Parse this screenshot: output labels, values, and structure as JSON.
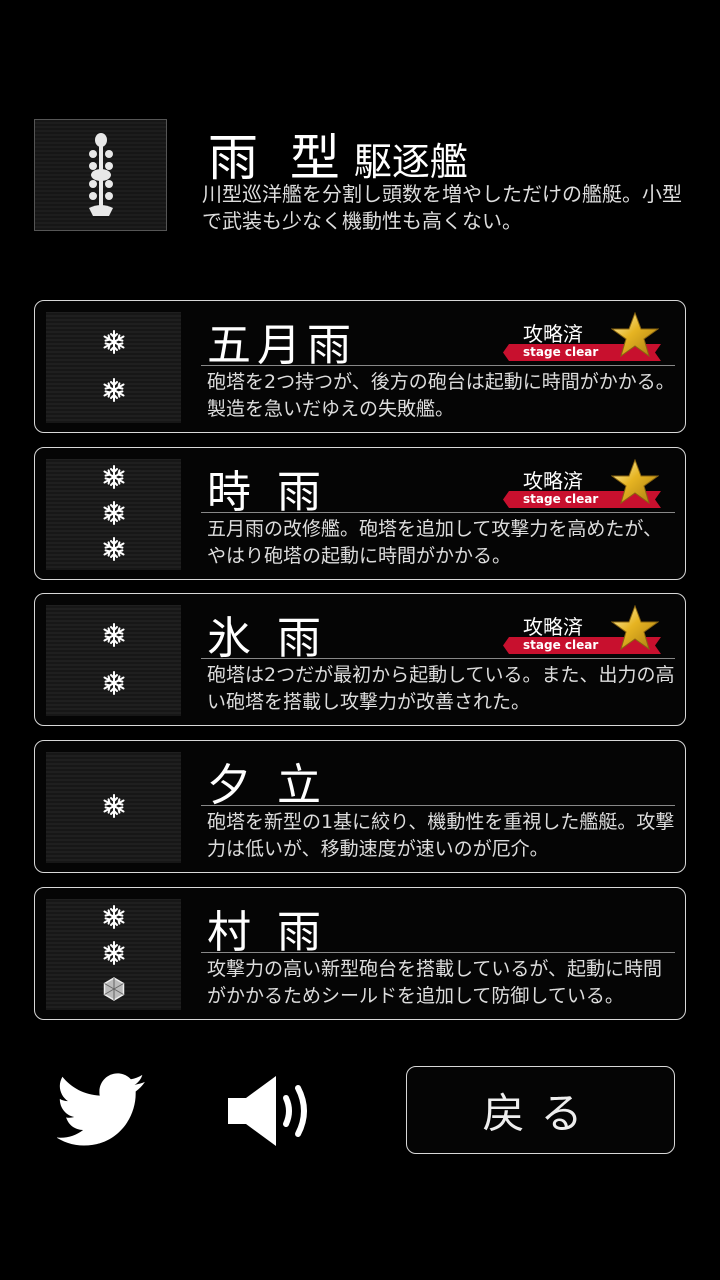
{
  "header": {
    "icon": "destroyer-class-emblem-icon",
    "name": "雨 型",
    "ship_class": "駆逐艦",
    "description": "川型巡洋艦を分割し頭数を増やしただけの艦艇。小型で武装も少なく機動性も高くない。"
  },
  "ships": [
    {
      "name": "五月雨",
      "description": "砲塔を2つ持つが、後方の砲台は起動に時間がかかる。製造を急いだゆえの失敗艦。",
      "cleared": true,
      "turrets": [
        "snowflake-turret-icon",
        "snowflake-turret-icon"
      ]
    },
    {
      "name": "時 雨",
      "description": "五月雨の改修艦。砲塔を追加して攻撃力を高めたが、やはり砲塔の起動に時間がかかる。",
      "cleared": true,
      "turrets": [
        "snowflake-turret-icon",
        "snowflake-turret-icon",
        "snowflake-turret-icon"
      ]
    },
    {
      "name": "氷 雨",
      "description": "砲塔は2つだが最初から起動している。また、出力の高い砲塔を搭載し攻撃力が改善された。",
      "cleared": true,
      "turrets": [
        "snowflake-turret-icon",
        "snowflake-turret-icon"
      ]
    },
    {
      "name": "夕 立",
      "description": "砲塔を新型の1基に絞り、機動性を重視した艦艇。攻撃力は低いが、移動速度が速いのが厄介。",
      "cleared": false,
      "turrets": [
        "snowflake-turret-icon"
      ]
    },
    {
      "name": "村 雨",
      "description": "攻撃力の高い新型砲台を搭載しているが、起動に時間がかかるためシールドを追加して防御している。",
      "cleared": false,
      "turrets": [
        "snowflake-turret-icon",
        "snowflake-turret-icon",
        "hexagon-shield-icon"
      ]
    }
  ],
  "badge": {
    "label_jp": "攻略済",
    "label_en": "stage clear",
    "icon": "gold-star-icon",
    "ribbon_color": "#c8102e",
    "star_color": "#e6b422"
  },
  "footer": {
    "twitter_icon": "twitter-bird-icon",
    "sound_icon": "speaker-volume-icon",
    "back_label": "戻る"
  }
}
